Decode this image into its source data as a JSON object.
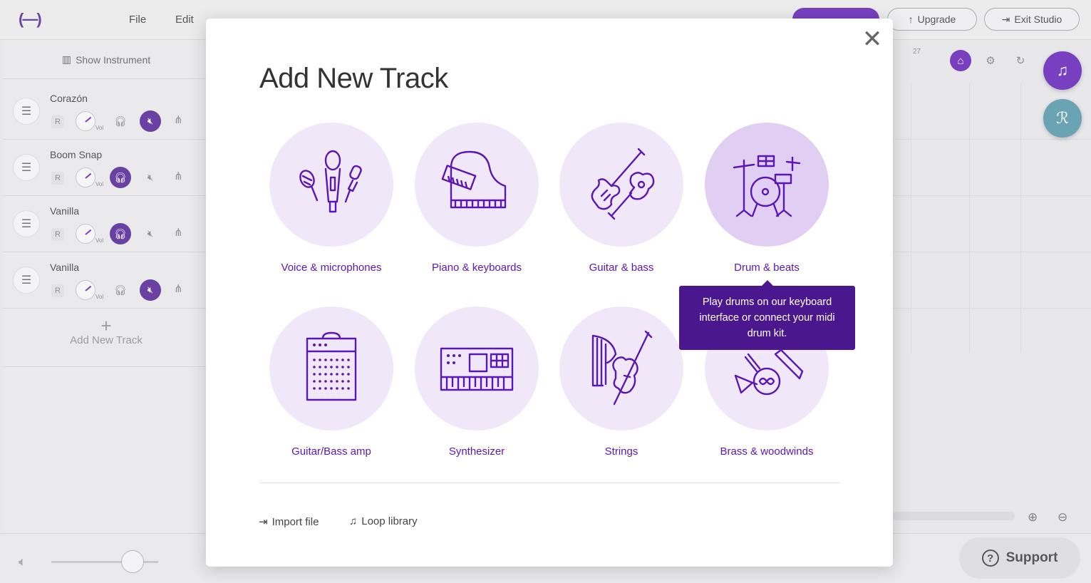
{
  "topbar": {
    "logo": "(—)",
    "menu": [
      "File",
      "Edit"
    ],
    "upgrade": "Upgrade",
    "exit_studio": "Exit Studio"
  },
  "left_panel": {
    "show_instrument": "Show Instrument",
    "tracks": [
      {
        "name": "Corazón",
        "r": "R",
        "vol": "Vol",
        "headphones_on": false,
        "muted": true
      },
      {
        "name": "Boom Snap",
        "r": "R",
        "vol": "Vol",
        "headphones_on": true,
        "muted": false
      },
      {
        "name": "Vanilla",
        "r": "R",
        "vol": "Vol",
        "headphones_on": true,
        "muted": false
      },
      {
        "name": "Vanilla",
        "r": "R",
        "vol": "Vol",
        "headphones_on": false,
        "muted": true
      }
    ],
    "add_new_track": "Add New Track"
  },
  "timeline": {
    "ruler_number": "27"
  },
  "support": "Support",
  "modal": {
    "title": "Add New Track",
    "close_glyph": "✕",
    "tiles": [
      {
        "label": "Voice & microphones",
        "icon": "microphones-icon"
      },
      {
        "label": "Piano & keyboards",
        "icon": "piano-icon"
      },
      {
        "label": "Guitar & bass",
        "icon": "guitar-icon"
      },
      {
        "label": "Drum & beats",
        "icon": "drum-kit-icon"
      },
      {
        "label": "Guitar/Bass amp",
        "icon": "amp-icon"
      },
      {
        "label": "Synthesizer",
        "icon": "synthesizer-icon"
      },
      {
        "label": "Strings",
        "icon": "strings-icon"
      },
      {
        "label": "Brass & woodwinds",
        "icon": "brass-icon"
      }
    ],
    "tooltip": "Play drums on our keyboard interface or connect your midi drum kit.",
    "import_file": "Import file",
    "loop_library": "Loop library"
  },
  "colors": {
    "accent": "#5b17b3",
    "tile_bg": "#f0e8f9",
    "tile_active_bg": "#e0cff3",
    "tooltip_bg": "#4a178f",
    "teal_fab": "#4a8fa3"
  }
}
